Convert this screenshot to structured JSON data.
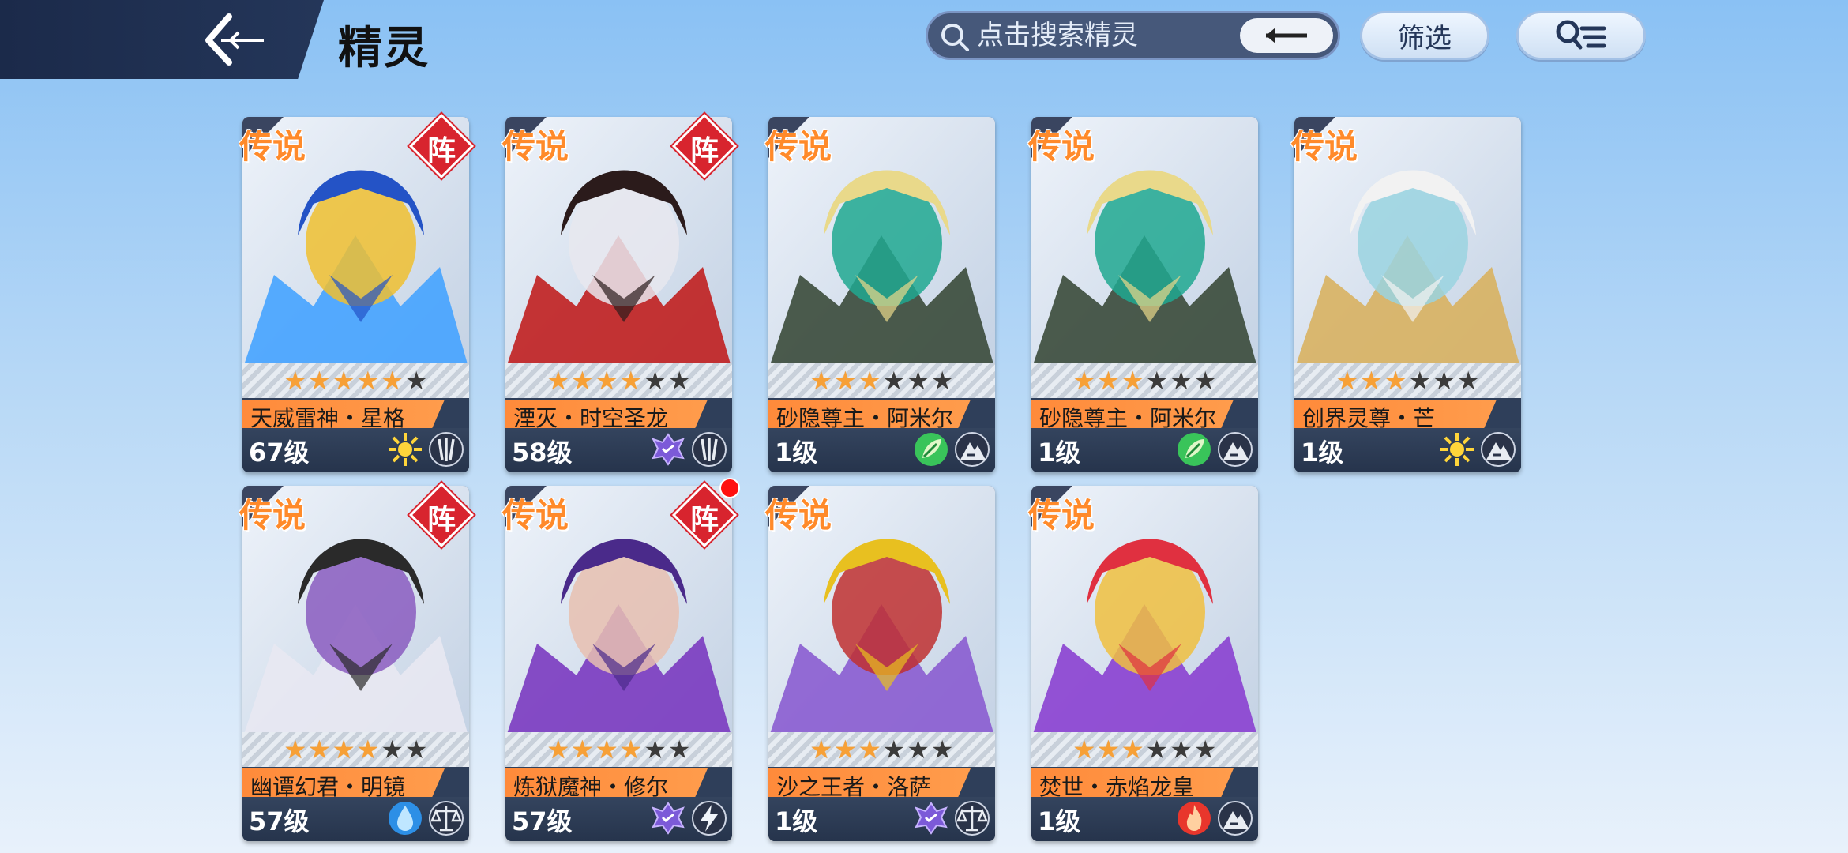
{
  "header": {
    "title": "精灵",
    "search": {
      "placeholder": "点击搜索精灵",
      "value": ""
    },
    "filter_label": "筛选"
  },
  "colors": {
    "rarity_text": "#ff8a2a",
    "formation_badge": "#d8242e",
    "name_ribbon": "#ff8a3a",
    "notify_dot": "#ff1010"
  },
  "cards": [
    {
      "rarity": "传说",
      "formation": "阵",
      "stars": 5,
      "name": "天威雷神・星格",
      "level": "67级",
      "attrs": [
        "light-icon",
        "claw-icon"
      ],
      "palette": [
        "#2453c6",
        "#45a3ff",
        "#f0c030"
      ],
      "notify": false
    },
    {
      "rarity": "传说",
      "formation": "阵",
      "stars": 4,
      "name": "湮灭・时空圣龙",
      "level": "58级",
      "attrs": [
        "shadow-icon",
        "claw-icon"
      ],
      "palette": [
        "#2b1b1b",
        "#c01f1f",
        "#e8e8ee"
      ],
      "notify": false
    },
    {
      "rarity": "传说",
      "formation": "",
      "stars": 3,
      "name": "砂隐尊主・阿米尔",
      "level": "1级",
      "attrs": [
        "grass-icon",
        "mountain-icon"
      ],
      "palette": [
        "#e9d98a",
        "#3a4a3a",
        "#20a890"
      ],
      "notify": false
    },
    {
      "rarity": "传说",
      "formation": "",
      "stars": 3,
      "name": "砂隐尊主・阿米尔",
      "level": "1级",
      "attrs": [
        "grass-icon",
        "mountain-icon"
      ],
      "palette": [
        "#e9d98a",
        "#3a4a3a",
        "#20a890"
      ],
      "notify": false
    },
    {
      "rarity": "传说",
      "formation": "",
      "stars": 3,
      "name": "创界灵尊・芒",
      "level": "1级",
      "attrs": [
        "light-icon",
        "mountain-icon"
      ],
      "palette": [
        "#f2f2f2",
        "#d8b160",
        "#9ad4e0"
      ],
      "notify": false
    },
    {
      "rarity": "传说",
      "formation": "阵",
      "stars": 4,
      "name": "幽谭幻君・明镜",
      "level": "57级",
      "attrs": [
        "water-icon",
        "balance-icon"
      ],
      "palette": [
        "#2a2a2a",
        "#e8e8f2",
        "#8a5cc0"
      ],
      "notify": false
    },
    {
      "rarity": "传说",
      "formation": "阵",
      "stars": 4,
      "name": "炼狱魔神・修尔",
      "level": "57级",
      "attrs": [
        "shadow-icon",
        "thunder-icon"
      ],
      "palette": [
        "#4a2a8a",
        "#7a3ac0",
        "#e8c0b0"
      ],
      "notify": true
    },
    {
      "rarity": "传说",
      "formation": "",
      "stars": 3,
      "name": "沙之王者・洛萨",
      "level": "1级",
      "attrs": [
        "shadow-icon",
        "balance-icon"
      ],
      "palette": [
        "#e8c020",
        "#8a5cd0",
        "#c03030"
      ],
      "notify": false
    },
    {
      "rarity": "传说",
      "formation": "",
      "stars": 3,
      "name": "焚世・赤焰龙皇",
      "level": "1级",
      "attrs": [
        "fire-icon",
        "mountain-icon"
      ],
      "palette": [
        "#e03040",
        "#8a40d0",
        "#f0c040"
      ],
      "notify": false
    }
  ]
}
